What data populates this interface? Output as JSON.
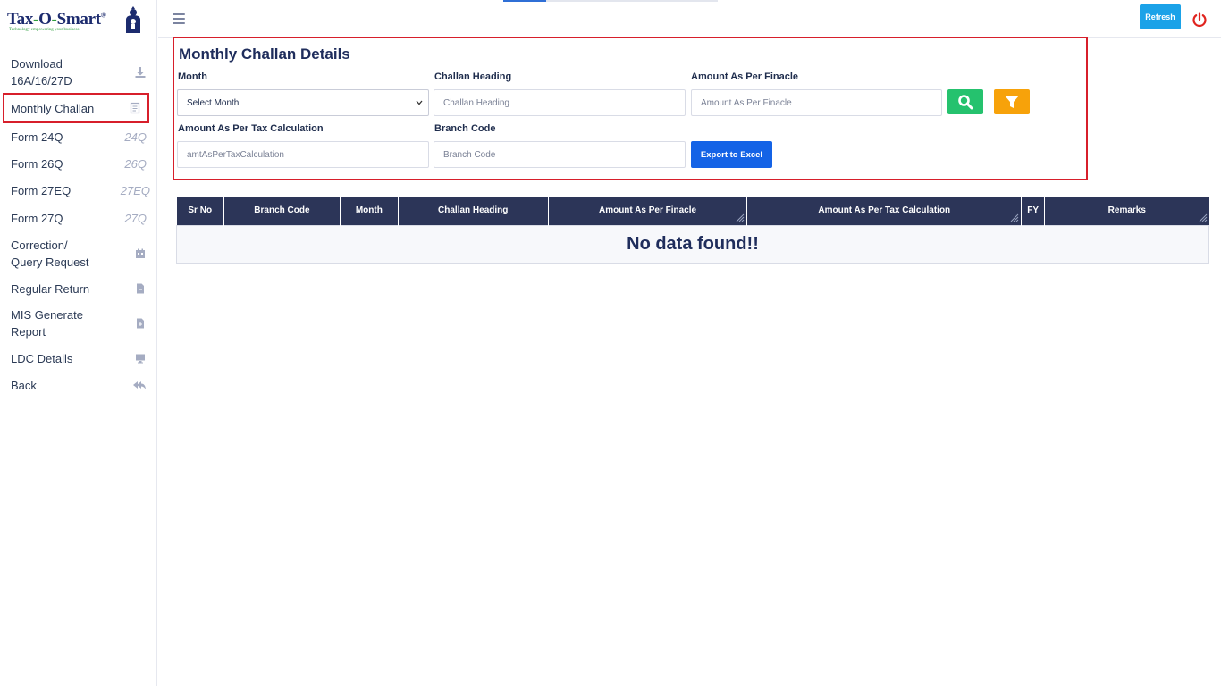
{
  "brand": {
    "name_part1": "Tax",
    "name_dash1": "-",
    "name_part2": "O",
    "name_dash2": "-",
    "name_part3": "Smart",
    "reg": "®",
    "tagline": "Technology empowering your business"
  },
  "sidebar": {
    "items": [
      {
        "label": "Download\n16A/16/27D",
        "icon": "download-icon"
      },
      {
        "label": "Monthly Challan",
        "icon": "document-icon",
        "active": true
      },
      {
        "label": "Form 24Q",
        "tag": "24Q"
      },
      {
        "label": "Form 26Q",
        "tag": "26Q"
      },
      {
        "label": "Form 27EQ",
        "tag": "27EQ"
      },
      {
        "label": "Form 27Q",
        "tag": "27Q"
      },
      {
        "label": "Correction/\nQuery Request",
        "icon": "calendar-icon"
      },
      {
        "label": "Regular Return",
        "icon": "file-icon"
      },
      {
        "label": "MIS Generate\nReport",
        "icon": "file-add-icon"
      },
      {
        "label": "LDC Details",
        "icon": "monitor-icon"
      },
      {
        "label": "Back",
        "icon": "reply-all-icon"
      }
    ]
  },
  "topbar": {
    "refresh_label": "Refresh",
    "power_icon": "power-icon",
    "menu_icon": "hamburger-icon"
  },
  "form": {
    "title": "Monthly Challan Details",
    "month_label": "Month",
    "month_value": "Select Month",
    "challan_heading_label": "Challan Heading",
    "challan_heading_placeholder": "Challan Heading",
    "amount_finacle_label": "Amount As Per Finacle",
    "amount_finacle_placeholder": "Amount As Per Finacle",
    "amount_tax_label": "Amount As Per Tax Calculation",
    "amount_tax_placeholder": "amtAsPerTaxCalculation",
    "branch_code_label": "Branch Code",
    "branch_code_placeholder": "Branch Code",
    "export_label": "Export to Excel",
    "search_icon": "search-icon",
    "filter_icon": "filter-icon"
  },
  "table": {
    "columns": [
      "Sr No",
      "Branch Code",
      "Month",
      "Challan Heading",
      "Amount As Per Finacle",
      "Amount As Per Tax Calculation",
      "FY",
      "Remarks"
    ],
    "empty_message": "No data found!!"
  },
  "colors": {
    "accent_red": "#d71f2b",
    "header_navy": "#2c3558",
    "search_green": "#25c26e",
    "filter_orange": "#f7a20a",
    "export_blue": "#1463e6",
    "refresh_blue": "#1ba2e8"
  }
}
